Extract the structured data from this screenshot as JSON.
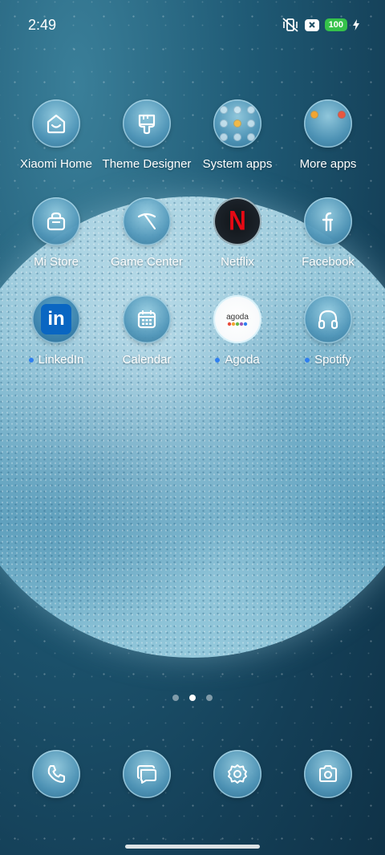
{
  "status_bar": {
    "time": "2:49",
    "battery": "100",
    "icons": [
      "mute-vibrate-icon",
      "x-box-icon",
      "battery-icon",
      "charging-bolt-icon"
    ]
  },
  "apps": [
    {
      "label": "Xiaomi Home",
      "icon": "xiaomi-home-icon",
      "new": false
    },
    {
      "label": "Theme Designer",
      "icon": "brush-icon",
      "new": false
    },
    {
      "label": "System apps",
      "icon": "folder-icon",
      "new": false
    },
    {
      "label": "More apps",
      "icon": "folder-icon",
      "new": false
    },
    {
      "label": "Mi Store",
      "icon": "shopping-bag-icon",
      "new": false
    },
    {
      "label": "Game Center",
      "icon": "game-center-icon",
      "new": false
    },
    {
      "label": "Netflix",
      "icon": "netflix-icon",
      "new": false
    },
    {
      "label": "Facebook",
      "icon": "facebook-icon",
      "new": false
    },
    {
      "label": "LinkedIn",
      "icon": "linkedin-icon",
      "new": true
    },
    {
      "label": "Calendar",
      "icon": "calendar-icon",
      "new": false
    },
    {
      "label": "Agoda",
      "icon": "agoda-icon",
      "new": true,
      "logo_text": "agoda"
    },
    {
      "label": "Spotify",
      "icon": "headphones-icon",
      "new": true
    }
  ],
  "netflix_letter": "N",
  "linkedin_letters": "in",
  "pager": {
    "pages": 3,
    "active": 2
  },
  "dock": [
    {
      "name": "phone",
      "icon": "phone-icon"
    },
    {
      "name": "messages",
      "icon": "messages-icon"
    },
    {
      "name": "settings",
      "icon": "gear-icon"
    },
    {
      "name": "camera",
      "icon": "camera-icon"
    }
  ],
  "colors": {
    "badge_dot": "#2f7ff0",
    "battery": "#35c24a",
    "netflix_red": "#e50914",
    "linkedin_blue": "#0a66c2"
  }
}
